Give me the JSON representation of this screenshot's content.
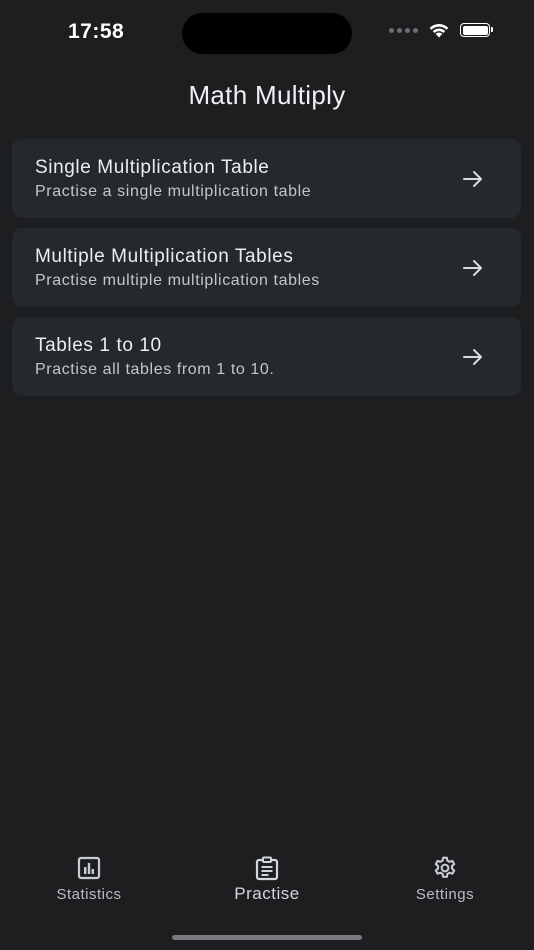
{
  "status_bar": {
    "time": "17:58",
    "battery_level": 1.0
  },
  "header": {
    "title": "Math Multiply"
  },
  "options": [
    {
      "title": "Single Multiplication Table",
      "subtitle": "Practise a single multiplication table",
      "icon": "arrow-right-icon"
    },
    {
      "title": "Multiple Multiplication Tables",
      "subtitle": "Practise multiple multiplication tables",
      "icon": "arrow-right-icon"
    },
    {
      "title": "Tables 1 to 10",
      "subtitle": "Practise all tables from 1 to 10.",
      "icon": "arrow-right-icon"
    }
  ],
  "nav": {
    "items": [
      {
        "label": "Statistics",
        "icon": "bar-chart-icon",
        "active": false
      },
      {
        "label": "Practise",
        "icon": "clipboard-icon",
        "active": true
      },
      {
        "label": "Settings",
        "icon": "gear-icon",
        "active": false
      }
    ]
  },
  "colors": {
    "background": "#1d1e20",
    "card": "#25282c",
    "text_primary": "#eceef1",
    "text_secondary": "#c3c6cb",
    "icon": "#c9ccd1"
  }
}
